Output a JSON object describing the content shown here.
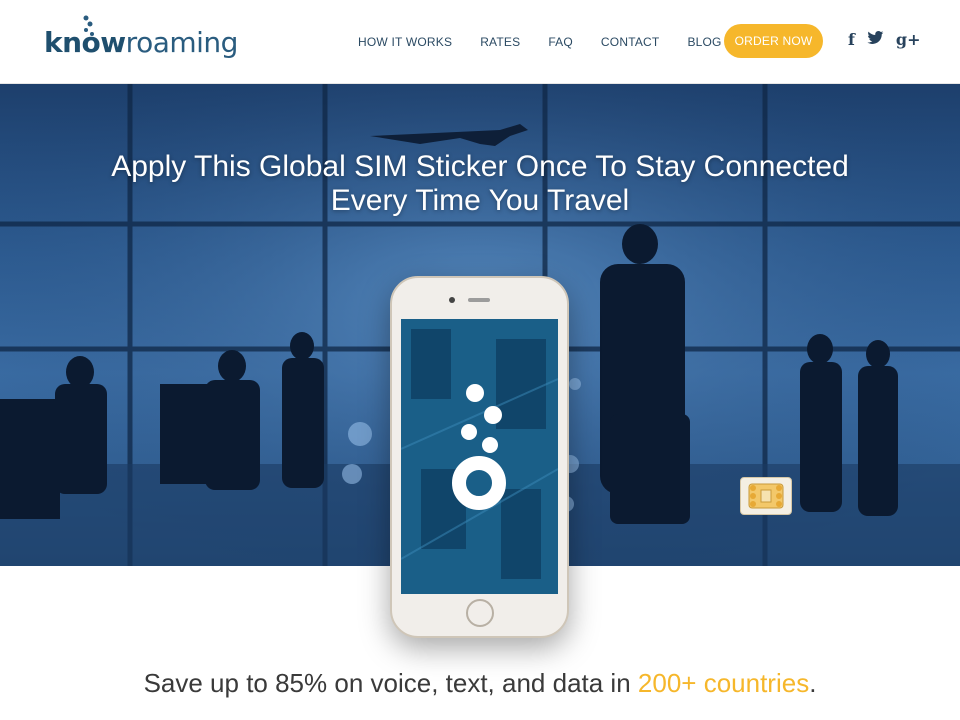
{
  "header": {
    "logo": {
      "part1": "know",
      "part2": "roaming"
    },
    "nav": [
      {
        "label": "HOW IT WORKS"
      },
      {
        "label": "RATES"
      },
      {
        "label": "FAQ"
      },
      {
        "label": "CONTACT"
      },
      {
        "label": "BLOG"
      }
    ],
    "order_button": "ORDER NOW",
    "social": {
      "facebook": "f",
      "twitter": "twitter-icon",
      "google": "g+"
    }
  },
  "hero": {
    "title_line1": "Apply This Global SIM Sticker Once To Stay Connected",
    "title_line2": "Every Time You Travel"
  },
  "tagline": {
    "before": "Save up to 85% on voice, text, and data in ",
    "highlight": "200+ countries",
    "after": "."
  },
  "colors": {
    "accent": "#f6b72b",
    "brand": "#1f4f6e",
    "hero_blue": "#2d5c92"
  }
}
